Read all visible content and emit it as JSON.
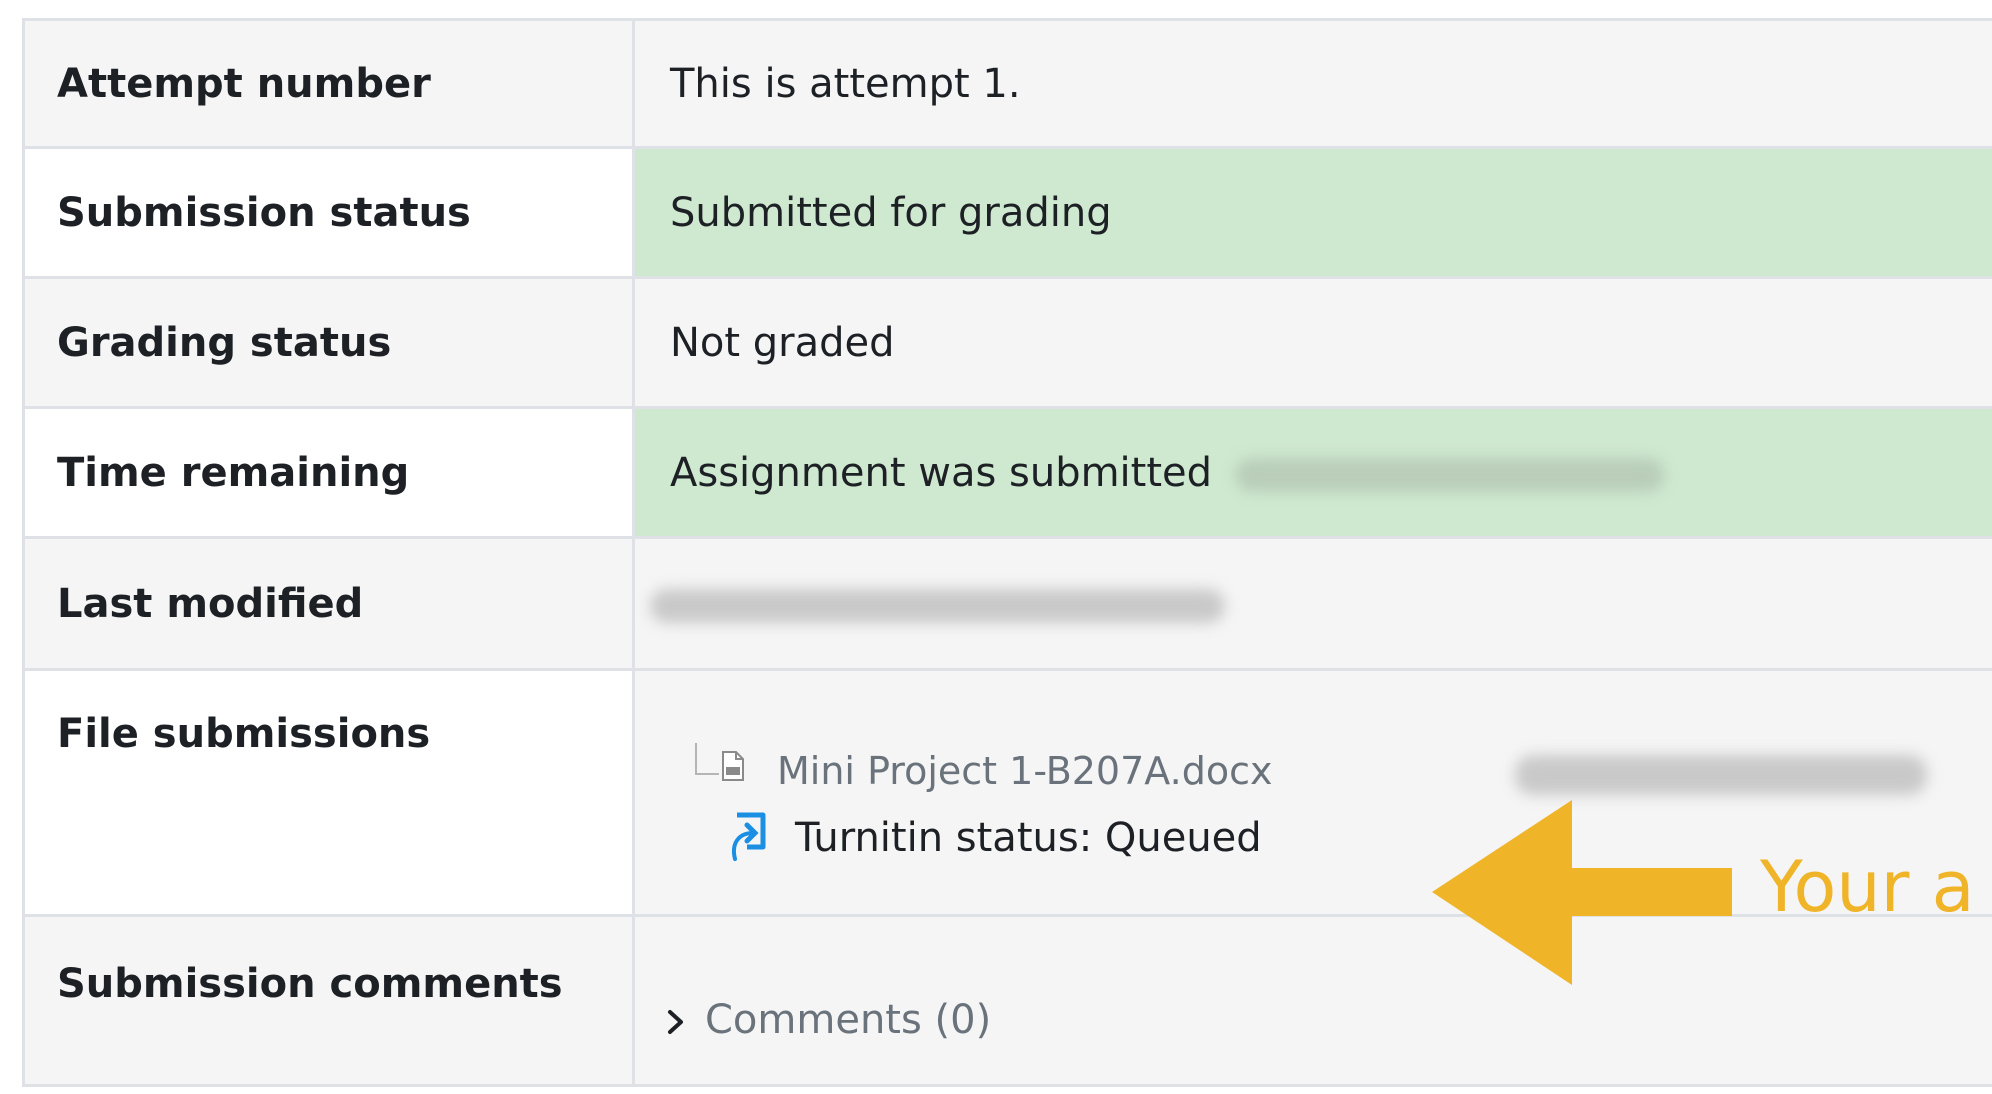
{
  "rows": [
    {
      "label": "Attempt number",
      "value": "This is attempt 1."
    },
    {
      "label": "Submission status",
      "value": "Submitted for grading"
    },
    {
      "label": "Grading status",
      "value": "Not graded"
    },
    {
      "label": "Time remaining",
      "value": "Assignment was submitted"
    },
    {
      "label": "Last modified",
      "value": ""
    },
    {
      "label": "File submissions"
    },
    {
      "label": "Submission comments"
    }
  ],
  "file": {
    "name": "Mini Project 1-B207A.docx",
    "turnitin_status": "Turnitin status: Queued"
  },
  "comments": {
    "link_label": "Comments (0)"
  },
  "callout": {
    "text": "Your a",
    "color": "#f0b429"
  },
  "colors": {
    "success_bg": "#cfe9d0",
    "neutral_bg": "#f5f5f5",
    "border": "#dee2e6",
    "link_muted": "#6a737b",
    "turnitin_blue": "#1a8fe3"
  },
  "icons": [
    "doc-file-icon",
    "turnitin-icon",
    "chevron-right-icon",
    "arrow-left-icon"
  ]
}
